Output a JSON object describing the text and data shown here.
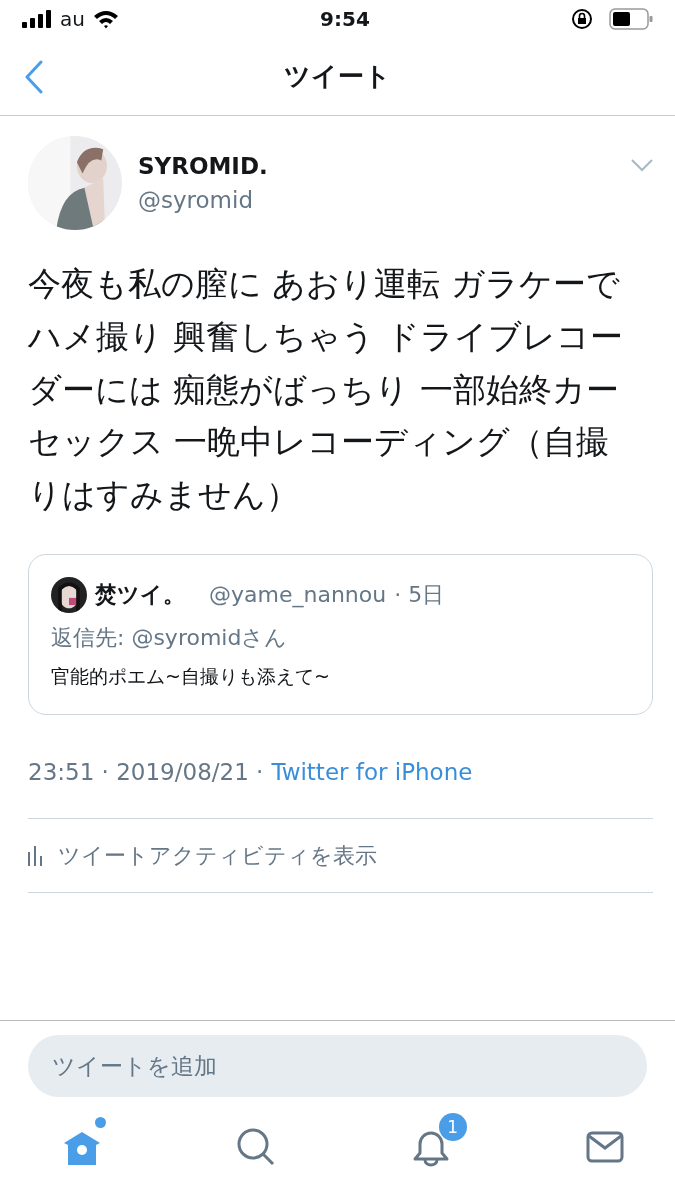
{
  "status_bar": {
    "carrier": "au",
    "time": "9:54"
  },
  "nav": {
    "title": "ツイート"
  },
  "tweet": {
    "name": "SYROMID.",
    "handle": "@syromid",
    "text": "今夜も私の膣に あおり運転 ガラケーでハメ撮り 興奮しちゃう ドライブレコーダーには 痴態がばっちり 一部始終カーセックス 一晩中レコーディング（自撮りはすみません）",
    "quote": {
      "name": "焚ツイ。",
      "handle": "@yame_nannou",
      "time": "· 5日",
      "reply_to": "返信先: @syromidさん",
      "text": "官能的ポエム~自撮りも添えて~"
    },
    "time": "23:51 · 2019/08/21 ·",
    "source": "Twitter for iPhone",
    "activity": "ツイートアクティビティを表示"
  },
  "reply_field": {
    "placeholder": "ツイートを追加"
  },
  "tab_bar": [
    {
      "kind": "home",
      "selected": true,
      "dot": true
    },
    {
      "kind": "search",
      "selected": false
    },
    {
      "kind": "notifications",
      "selected": false,
      "badge": "1"
    },
    {
      "kind": "messages",
      "selected": false
    }
  ]
}
